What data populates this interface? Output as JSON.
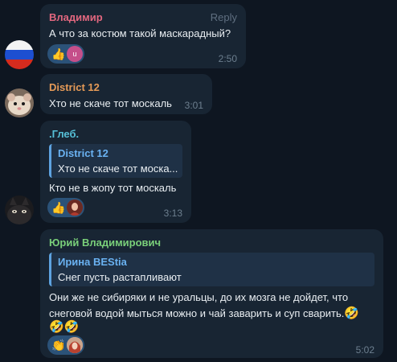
{
  "messages": [
    {
      "sender": "Владимир",
      "sender_color": "#e2677f",
      "text": "А что за костюм такой маскарадный?",
      "time": "2:50",
      "reply_label": "Reply",
      "reactions": [
        {
          "emoji": "👍",
          "avatar_initial": "u"
        }
      ]
    },
    {
      "sender": "District 12",
      "sender_color": "#e59a57",
      "text": "Хто не скаче тот москаль",
      "time": "3:01"
    },
    {
      "sender": ".Глеб.",
      "sender_color": "#56c0d7",
      "quote": {
        "name": "District 12",
        "text": "Хто не скаче тот моска..."
      },
      "text": "Кто не в жопу тот москаль",
      "time": "3:13",
      "reactions": [
        {
          "emoji": "👍"
        }
      ]
    },
    {
      "sender": "Юрий Владимирович",
      "sender_color": "#7ad07a",
      "quote": {
        "name": "Ирина BEStia",
        "text": "Снег пусть растапливают"
      },
      "text_line1": "Они же не сибиряки и не уральцы, до их мозга не дойдет, что",
      "text_line2": "снеговой водой мыться можно и чай заварить и суп сварить.",
      "text_emoji_end": "🤣",
      "text_emoji_row": "🤣🤣",
      "time": "5:02",
      "reactions": [
        {
          "emoji": "👏"
        }
      ]
    }
  ]
}
